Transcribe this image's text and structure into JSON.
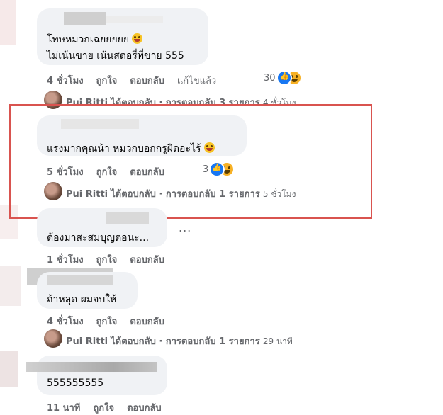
{
  "comments": [
    {
      "lines": [
        "โทษหมวกเฉยยยยย",
        "ไม่เน้นขาย เน้นสตอรี่ที่ขาย 555"
      ],
      "emoji": "grin-emoji",
      "actions": {
        "time": "4 ชั่วโมง",
        "like": "ถูกใจ",
        "reply": "ตอบกลับ",
        "edited": "แก้ไขแล้ว"
      },
      "reaction_count": "30",
      "reply_summary": {
        "name": "Pui Ritti",
        "text": "ได้ตอบกลับ · การตอบกลับ 3 รายการ",
        "time": "4 ชั่วโมง"
      }
    },
    {
      "lines": [
        "แรงมากคุณน้า หมวกบอกกรูผิดอะไร้"
      ],
      "emoji": "grin-emoji",
      "actions": {
        "time": "5 ชั่วโมง",
        "like": "ถูกใจ",
        "reply": "ตอบกลับ"
      },
      "reaction_count": "3",
      "reply_summary": {
        "name": "Pui Ritti",
        "text": "ได้ตอบกลับ · การตอบกลับ 1 รายการ",
        "time": "5 ชั่วโมง"
      }
    },
    {
      "lines": [
        "ต้องมาสะสมบุญต่อนะ..."
      ],
      "more": "...",
      "actions": {
        "time": "1 ชั่วโมง",
        "like": "ถูกใจ",
        "reply": "ตอบกลับ"
      }
    },
    {
      "lines": [
        "ถ้าหลุด ผมจบให้"
      ],
      "actions": {
        "time": "4 ชั่วโมง",
        "like": "ถูกใจ",
        "reply": "ตอบกลับ"
      },
      "reply_summary": {
        "name": "Pui Ritti",
        "text": "ได้ตอบกลับ · การตอบกลับ 1 รายการ",
        "time": "29 นาที"
      }
    },
    {
      "lines": [
        "555555555"
      ],
      "actions": {
        "time": "11 นาที",
        "like": "ถูกใจ",
        "reply": "ตอบกลับ"
      }
    }
  ],
  "colors": {
    "highlight": "#d9534f",
    "bubble": "#f0f2f5",
    "like": "#1877f2",
    "haha": "#f7b125"
  }
}
